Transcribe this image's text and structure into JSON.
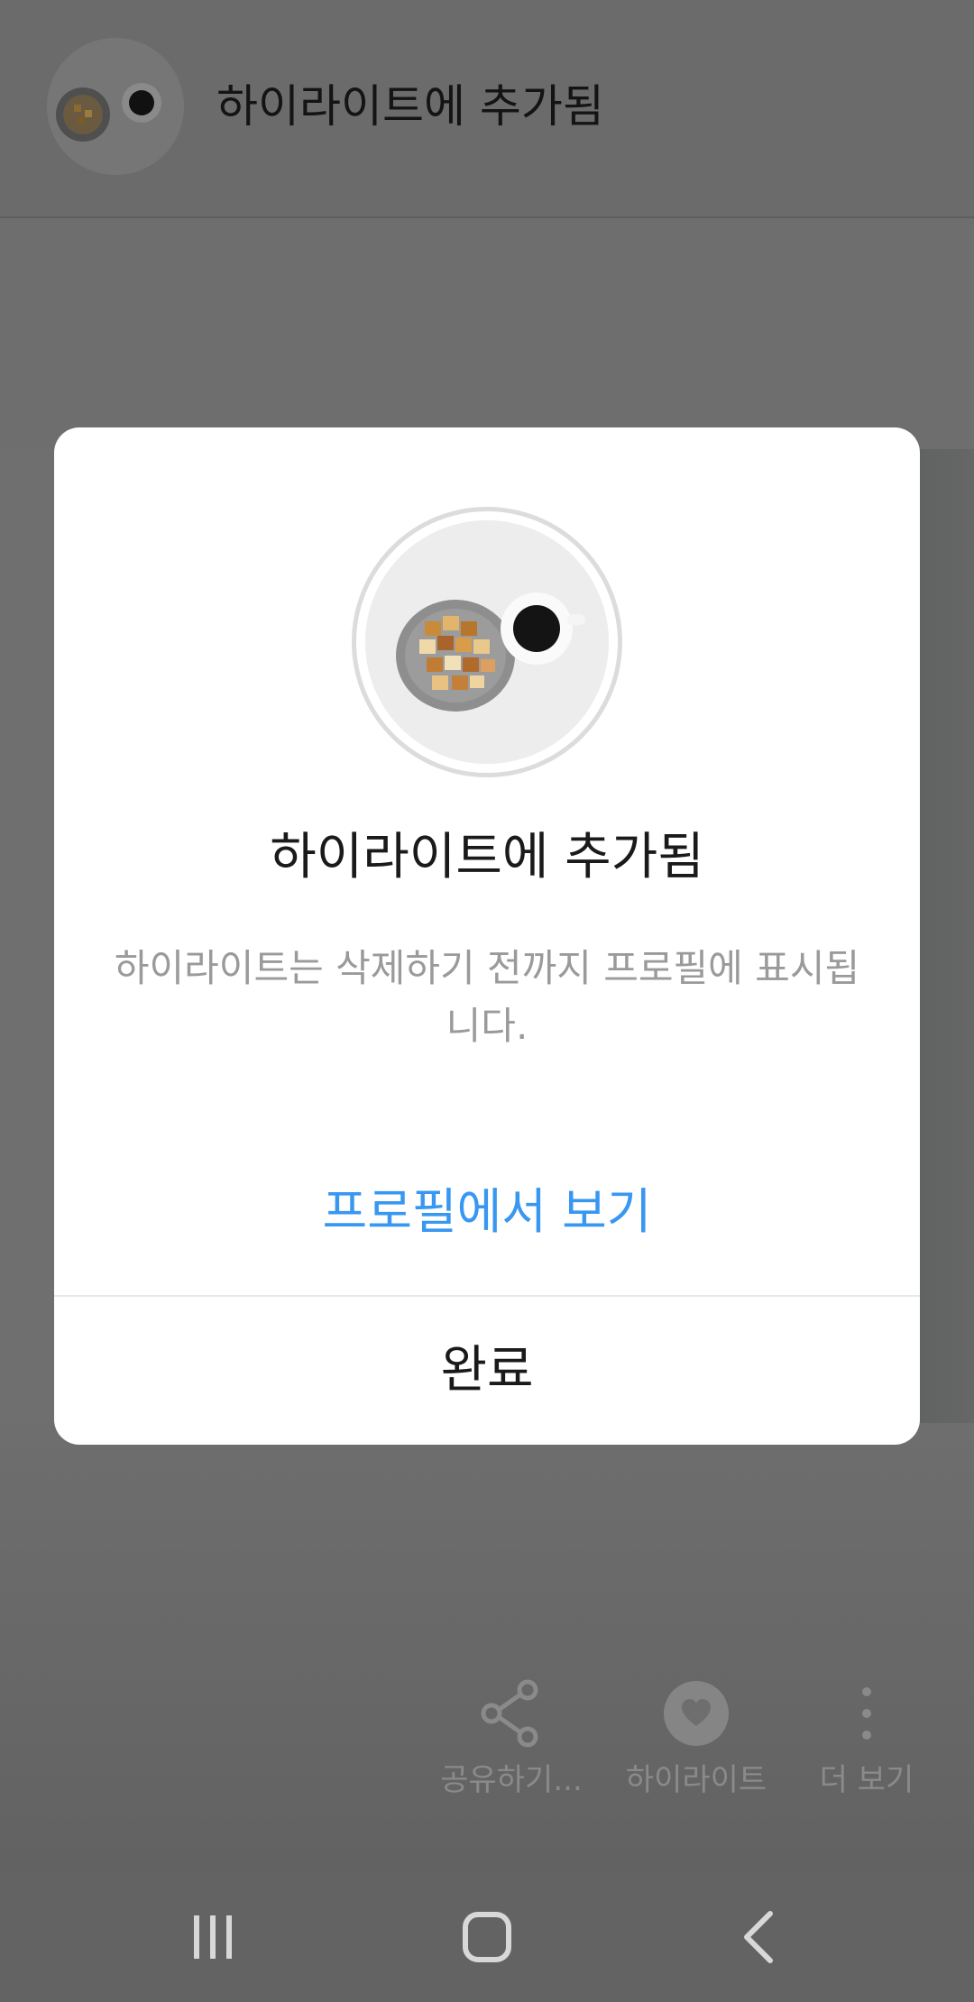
{
  "header": {
    "title": "하이라이트에 추가됨"
  },
  "actions": [
    {
      "label": "공유하기...",
      "icon": "share-icon"
    },
    {
      "label": "하이라이트",
      "icon": "heart-icon"
    },
    {
      "label": "더 보기",
      "icon": "more-vertical-icon"
    }
  ],
  "dialog": {
    "title": "하이라이트에 추가됨",
    "body": "하이라이트는 삭제하기 전까지 프로필에 표시됩니다.",
    "link_label": "프로필에서 보기",
    "done_label": "완료"
  },
  "navbar": {
    "recent_icon": "recent-apps-icon",
    "home_icon": "home-icon",
    "back_icon": "back-icon"
  },
  "colors": {
    "accent": "#3897f0",
    "overlay": "#6e6e6e",
    "dialog_bg": "#ffffff"
  }
}
